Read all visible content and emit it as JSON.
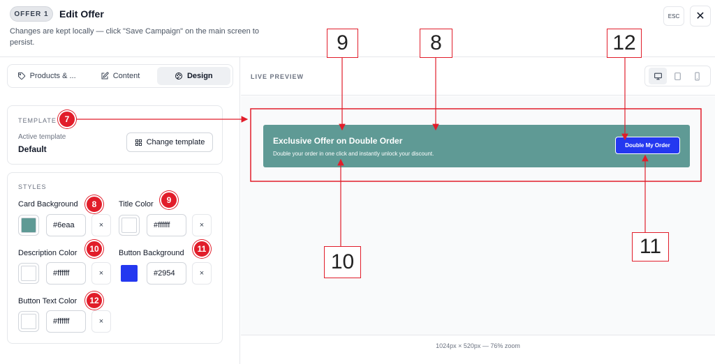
{
  "header": {
    "offer_pill": "OFFER 1",
    "title": "Edit Offer",
    "note": "Changes are kept locally — click \"Save Campaign\" on the main screen to persist.",
    "esc_label": "ESC",
    "close_glyph": "✕"
  },
  "tabs": [
    {
      "label": "Products & ...",
      "icon": "tag-icon",
      "active": false
    },
    {
      "label": "Content",
      "icon": "edit-icon",
      "active": false
    },
    {
      "label": "Design",
      "icon": "palette-icon",
      "active": true
    }
  ],
  "template": {
    "section_label": "TEMPLATE",
    "active_label": "Active template",
    "active_value": "Default",
    "change_button": "Change template"
  },
  "styles": {
    "section_label": "STYLES",
    "card_background": {
      "label": "Card Background",
      "value": "#6eaa",
      "swatch": "#5f9a95"
    },
    "title_color": {
      "label": "Title Color",
      "value": "#ffffff",
      "swatch": "#ffffff"
    },
    "description_color": {
      "label": "Description Color",
      "value": "#ffffff",
      "swatch": "#ffffff"
    },
    "button_background": {
      "label": "Button Background",
      "value": "#2954",
      "swatch": "#2438f0"
    },
    "button_text_color": {
      "label": "Button Text Color",
      "value": "#ffffff",
      "swatch": "#ffffff"
    },
    "clear_glyph": "×"
  },
  "preview": {
    "title": "LIVE PREVIEW",
    "devices": [
      "desktop-icon",
      "tablet-icon",
      "mobile-icon"
    ],
    "offer": {
      "title": "Exclusive Offer on Double Order",
      "description": "Double your order in one click and instantly unlock your discount.",
      "button": "Double My Order",
      "card_color": "#5f9a95",
      "text_color": "#ffffff",
      "button_color": "#2438f0",
      "button_text_color": "#ffffff"
    },
    "footer": "1024px × 520px — 76% zoom"
  },
  "annotations": {
    "badges": [
      "7",
      "8",
      "9",
      "10",
      "11",
      "12"
    ],
    "callouts": [
      "9",
      "8",
      "12",
      "10",
      "11"
    ],
    "accent_color": "#e11d2a"
  }
}
